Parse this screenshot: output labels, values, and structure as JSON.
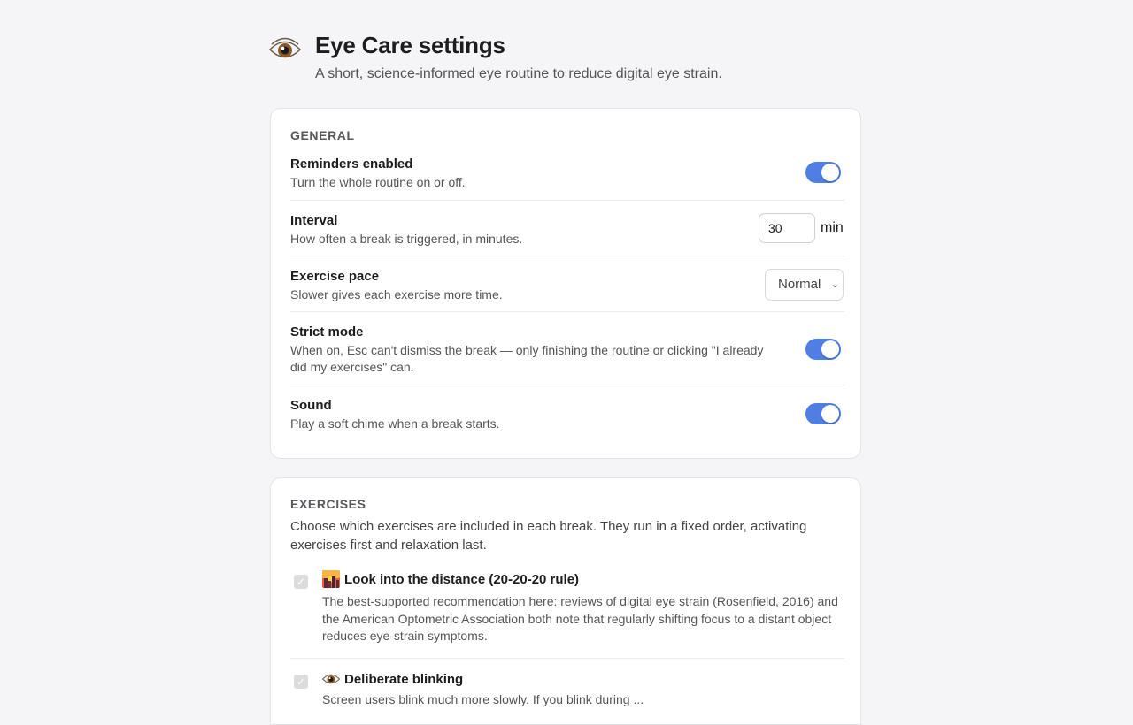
{
  "header": {
    "icon": "eye-icon",
    "title": "Eye Care settings",
    "subtitle": "A short, science-informed eye routine to reduce digital eye strain."
  },
  "general": {
    "section_title": "GENERAL",
    "reminders": {
      "label": "Reminders enabled",
      "desc": "Turn the whole routine on or off.",
      "on": true
    },
    "interval": {
      "label": "Interval",
      "desc": "How often a break is triggered, in minutes.",
      "value": "30",
      "unit": "min"
    },
    "pace": {
      "label": "Exercise pace",
      "desc": "Slower gives each exercise more time.",
      "selected": "Normal"
    },
    "strict": {
      "label": "Strict mode",
      "desc": "When on, Esc can't dismiss the break — only finishing the routine or clicking \"I already did my exercises\" can.",
      "on": true
    },
    "sound": {
      "label": "Sound",
      "desc": "Play a soft chime when a break starts.",
      "on": true
    }
  },
  "exercises": {
    "section_title": "EXERCISES",
    "intro": "Choose which exercises are included in each break. They run in a fixed order, activating exercises first and relaxation last.",
    "items": [
      {
        "icon": "sunset-city-icon",
        "title": "Look into the distance (20-20-20 rule)",
        "desc": "The best-supported recommendation here: reviews of digital eye strain (Rosenfield, 2016) and the American Optometric Association both note that regularly shifting focus to a distant object reduces eye-strain symptoms.",
        "checked": true
      },
      {
        "icon": "eye-icon",
        "title": "Deliberate blinking",
        "desc": "Screen users blink much more slowly. If you blink during ...",
        "checked": true
      }
    ]
  },
  "colors": {
    "accent": "#4f7fe2",
    "background": "#f5f5f7",
    "card": "#ffffff"
  }
}
